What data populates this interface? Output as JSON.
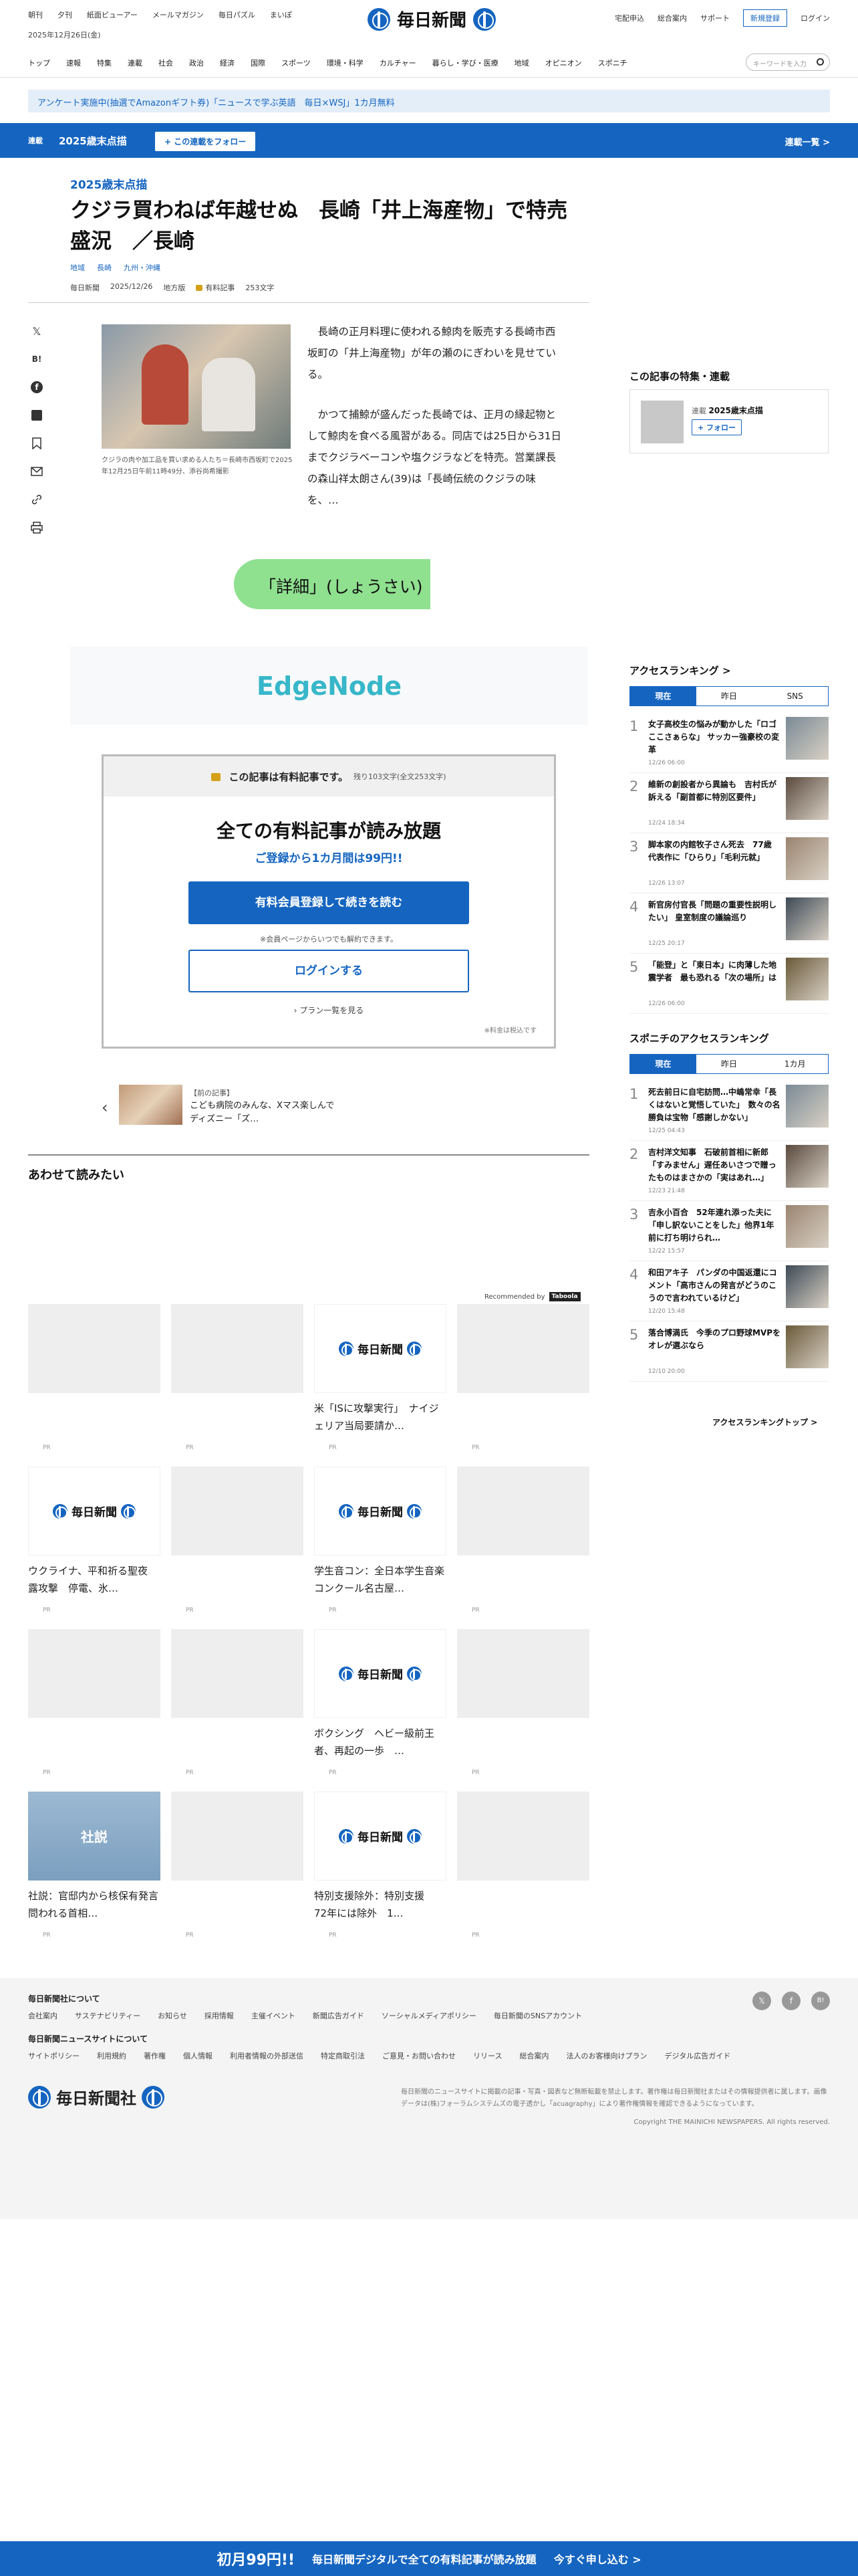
{
  "header": {
    "top_links": [
      "朝刊",
      "夕刊",
      "紙面ビューアー",
      "メールマガジン",
      "毎日パズル",
      "まいぽ"
    ],
    "date": "2025年12月26日(金)",
    "logo_text": "毎日新聞",
    "right_links": [
      "宅配申込",
      "総合案内",
      "サポート"
    ],
    "register": "新規登録",
    "login": "ログイン"
  },
  "nav": {
    "items": [
      "トップ",
      "速報",
      "特集",
      "連載",
      "社会",
      "政治",
      "経済",
      "国際",
      "スポーツ",
      "環境・科学",
      "カルチャー",
      "暮らし・学び・医療",
      "地域",
      "オピニオン",
      "スポニチ"
    ],
    "search_placeholder": "キーワードを入力"
  },
  "notice": "アンケート実施中(抽選でAmazonギフト券)「ニュースで学ぶ英語　毎日×WSJ」1カ月無料",
  "series_bar": {
    "label": "連載",
    "title": "2025歳末点描",
    "follow": "+ この連載をフォロー",
    "list": "連載一覧 >"
  },
  "article": {
    "kicker": "2025歳末点描",
    "headline": "クジラ買わねば年越せぬ　長崎「井上海産物」で特売盛況　／長崎",
    "categories": [
      "地域",
      "長崎",
      "九州・沖縄"
    ],
    "meta": {
      "source": "毎日新聞",
      "date": "2025/12/26",
      "edition": "地方版",
      "paid": "有料記事",
      "chars": "253文字"
    },
    "caption": "クジラの肉や加工品を買い求める人たち＝長崎市西坂町で2025年12月25日午前11時49分、添谷尚希撮影",
    "paragraphs": [
      "長崎の正月料理に使われる鯨肉を販売する長崎市西坂町の「井上海産物」が年の瀬のにぎわいを見せている。",
      "かつて捕鯨が盛んだった長崎では、正月の縁起物として鯨肉を食べる風習がある。同店では25日から31日までクジラベーコンや塩クジラなどを特売。営業課長の森山祥太朗さん(39)は「長崎伝統のクジラの味を、…"
    ]
  },
  "share_icons": [
    "x-icon",
    "hatena-icon",
    "facebook-icon",
    "note-icon",
    "bookmark-icon",
    "mail-icon",
    "link-icon",
    "print-icon"
  ],
  "detail_button": "「詳細」(しょうさい)",
  "ad_banner": "EdgeNode",
  "paywall": {
    "head": "この記事は有料記事です。",
    "remaining": "残り103文字(全文253文字)",
    "title": "全ての有料記事が読み放題",
    "subtitle": "ご登録から1カ月間は99円!!",
    "register_btn": "有料会員登録して続きを読む",
    "note": "※会員ページからいつでも解約できます。",
    "login_btn": "ログインする",
    "plans": "プラン一覧を見る",
    "tax": "※料金は税込です"
  },
  "prev_article": {
    "label": "【前の記事】",
    "title": "こども病院のみんな、Xマス楽しんで　ディズニー「ズ…"
  },
  "recommend": {
    "heading": "あわせて読みたい",
    "by": "Recommended by",
    "brand": "Taboola",
    "pr": "PR",
    "np_logo": "毎日新聞",
    "cards": [
      {
        "title": "",
        "kind": "blank"
      },
      {
        "title": "",
        "kind": "blank"
      },
      {
        "title": "米「ISに攻撃実行」　ナイジェリア当局要請か…",
        "kind": "np"
      },
      {
        "title": "",
        "kind": "blank"
      },
      {
        "title": "ウクライナ、平和祈る聖夜　露攻撃　停電、氷…",
        "kind": "np"
      },
      {
        "title": "",
        "kind": "blank"
      },
      {
        "title": "学生音コン：全日本学生音楽コンクール名古屋…",
        "kind": "np"
      },
      {
        "title": "",
        "kind": "blank"
      },
      {
        "title": "",
        "kind": "blank"
      },
      {
        "title": "",
        "kind": "blank"
      },
      {
        "title": "ボクシング　ヘビー級前王者、再起の一歩　…",
        "kind": "np"
      },
      {
        "title": "",
        "kind": "blank"
      },
      {
        "title": "社説：官邸内から核保有発言　問われる首相…",
        "kind": "shasetsu",
        "badge": "社説"
      },
      {
        "title": "",
        "kind": "blank"
      },
      {
        "title": "特別支援除外：特別支援　72年には除外　1…",
        "kind": "np"
      },
      {
        "title": "",
        "kind": "blank"
      }
    ]
  },
  "sidebar": {
    "series_heading": "この記事の特集・連載",
    "series_label": "連載",
    "series_name": "2025歳末点描",
    "series_follow": "+ フォロー",
    "ranking_heading": "アクセスランキング >",
    "ranking_tabs": [
      "現在",
      "昨日",
      "SNS"
    ],
    "ranking": [
      {
        "num": "1",
        "title": "女子高校生の悩みが動かした「ロゴここさぁらな」 サッカー強豪校の変革",
        "date": "12/26 06:00"
      },
      {
        "num": "2",
        "title": "維新の創設者から異論も　吉村氏が訴える「副首都に特別区要件」",
        "date": "12/24 18:34"
      },
      {
        "num": "3",
        "title": "脚本家の内館牧子さん死去　77歳　代表作に「ひらり」「毛利元就」",
        "date": "12/26 13:07"
      },
      {
        "num": "4",
        "title": "新官房付官長「問題の重要性説明したい」 皇室制度の議論巡り",
        "date": "12/25 20:17"
      },
      {
        "num": "5",
        "title": "「能登」と「東日本」に肉薄した地震学者　最も恐れる「次の場所」は",
        "date": "12/26 06:00"
      }
    ],
    "sponichi_heading": "スポニチのアクセスランキング",
    "sponichi_tabs": [
      "現在",
      "昨日",
      "1カ月"
    ],
    "sponichi": [
      {
        "num": "1",
        "title": "死去前日に自宅訪問…中嶋常幸「長くはないと覚悟していた」　数々の名勝負は宝物「感謝しかない」",
        "date": "12/25 04:43"
      },
      {
        "num": "2",
        "title": "吉村洋文知事　石破前首相に新郎「すみません」遅任あいさつで贈ったものはまさかの「実はあれ…」",
        "date": "12/23 21:48"
      },
      {
        "num": "3",
        "title": "吉永小百合　52年連れ添った夫に「申し訳ないことをした」他界1年前に打ち明けられ…",
        "date": "12/22 15:57"
      },
      {
        "num": "4",
        "title": "和田アキ子　パンダの中国返還にコメント「高市さんの発言がどうのこうので言われているけど」",
        "date": "12/20 15:48"
      },
      {
        "num": "5",
        "title": "落合博満氏　今季のプロ野球MVPをオレが選ぶなら",
        "date": "12/10 20:00"
      }
    ],
    "ranking_top": "アクセスランキングトップ >"
  },
  "footer": {
    "about_heading": "毎日新聞社について",
    "about_links": [
      "会社案内",
      "サステナビリティー",
      "お知らせ",
      "採用情報",
      "主催イベント",
      "新聞広告ガイド",
      "ソーシャルメディアポリシー",
      "毎日新聞のSNSアカウント"
    ],
    "site_heading": "毎日新聞ニュースサイトについて",
    "site_links": [
      "サイトポリシー",
      "利用規約",
      "著作権",
      "個人情報",
      "利用者情報の外部送信",
      "特定商取引法",
      "ご意見・お問い合わせ",
      "リリース",
      "総合案内",
      "法人のお客様向けプラン",
      "デジタル広告ガイド"
    ],
    "social": [
      "x-icon",
      "facebook-icon",
      "hatena-icon"
    ],
    "logo_text": "毎日新聞社",
    "note": "毎日新聞のニュースサイトに掲載の記事・写真・図表など無断転載を禁止します。著作権は毎日新聞社またはその情報提供者に属します。画像データは(株)フォーラムシステムズの電子透かし「acuagraphy」により著作権情報を確認できるようになっています。",
    "copyright": "Copyright THE MAINICHI NEWSPAPERS. All rights reserved."
  },
  "bottom_bar": {
    "price": "初月99円!!",
    "message": "毎日新聞デジタルで全ての有料記事が読み放題",
    "cta": "今すぐ申し込む >"
  },
  "colors": {
    "brand": "#1565c0",
    "highlight": "#8fe08f",
    "ad_text": "#37b7c9"
  }
}
